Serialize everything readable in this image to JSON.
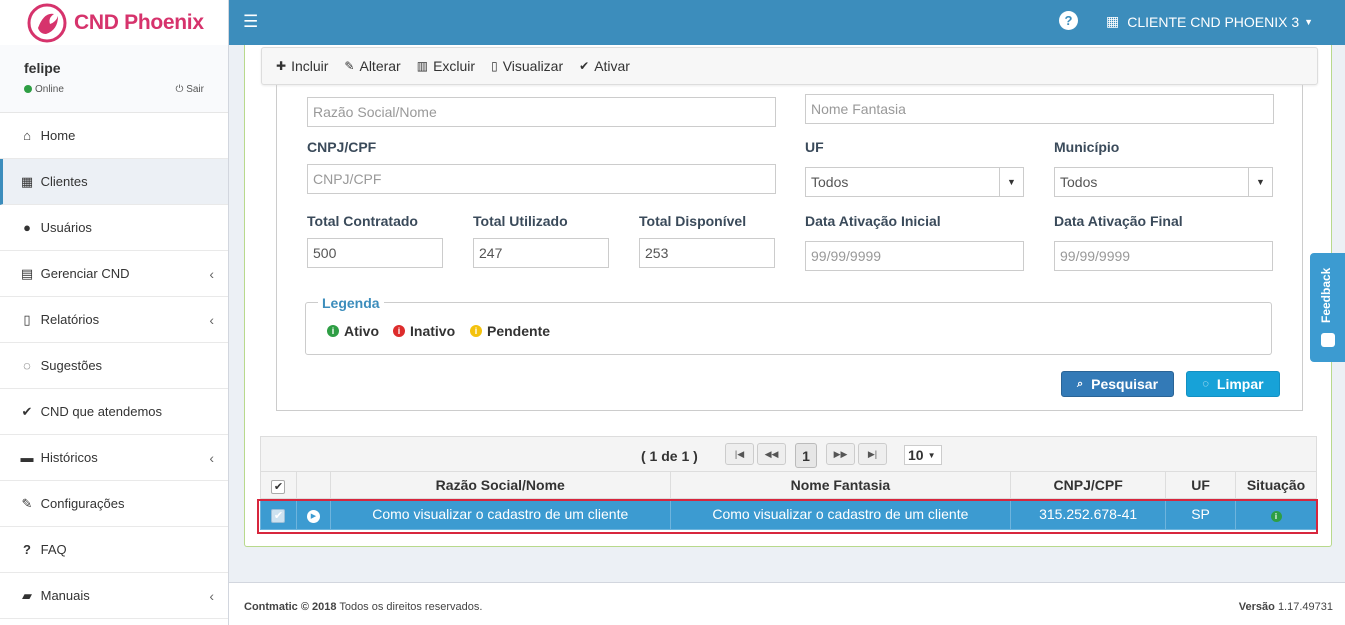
{
  "app": {
    "name": "CND Phoenix"
  },
  "user": {
    "name": "felipe",
    "status": "Online",
    "logout": "Sair"
  },
  "menu": [
    {
      "label": "Home",
      "icon": "home-icon"
    },
    {
      "label": "Clientes",
      "icon": "building-icon",
      "active": true
    },
    {
      "label": "Usuários",
      "icon": "user-icon"
    },
    {
      "label": "Gerenciar CND",
      "icon": "calendar-icon",
      "has_sub": true
    },
    {
      "label": "Relatórios",
      "icon": "file-icon",
      "has_sub": true
    },
    {
      "label": "Sugestões",
      "icon": "comments-icon"
    },
    {
      "label": "CND que atendemos",
      "icon": "check-icon"
    },
    {
      "label": "Históricos",
      "icon": "archive-icon",
      "has_sub": true
    },
    {
      "label": "Configurações",
      "icon": "wrench-icon"
    },
    {
      "label": "FAQ",
      "icon": "question-icon"
    },
    {
      "label": "Manuais",
      "icon": "book-icon",
      "has_sub": true
    }
  ],
  "topbar": {
    "client_label": "CLIENTE CND PHOENIX 3"
  },
  "toolbar": {
    "incluir": "Incluir",
    "alterar": "Alterar",
    "excluir": "Excluir",
    "visualizar": "Visualizar",
    "ativar": "Ativar"
  },
  "form": {
    "razao_placeholder": "Razão Social/Nome",
    "fantasia_placeholder": "Nome Fantasia",
    "cnpj_label": "CNPJ/CPF",
    "cnpj_placeholder": "CNPJ/CPF",
    "uf_label": "UF",
    "uf_value": "Todos",
    "municipio_label": "Município",
    "municipio_value": "Todos",
    "total_contratado_label": "Total Contratado",
    "total_contratado_value": "500",
    "total_utilizado_label": "Total Utilizado",
    "total_utilizado_value": "247",
    "total_disponivel_label": "Total Disponível",
    "total_disponivel_value": "253",
    "data_inicial_label": "Data Ativação Inicial",
    "data_inicial_placeholder": "99/99/9999",
    "data_final_label": "Data Ativação Final",
    "data_final_placeholder": "99/99/9999"
  },
  "legend": {
    "title": "Legenda",
    "ativo": "Ativo",
    "inativo": "Inativo",
    "pendente": "Pendente"
  },
  "buttons": {
    "pesquisar": "Pesquisar",
    "limpar": "Limpar"
  },
  "pager": {
    "text": "( 1 de 1 )",
    "page": "1",
    "size": "10"
  },
  "grid": {
    "headers": [
      "Razão Social/Nome",
      "Nome Fantasia",
      "CNPJ/CPF",
      "UF",
      "Situação"
    ],
    "rows": [
      {
        "razao": "Como visualizar o cadastro de um cliente",
        "fantasia": "Como visualizar o cadastro de um cliente",
        "cnpj": "315.252.678-41",
        "uf": "SP",
        "situacao": "Ativo"
      }
    ]
  },
  "footer": {
    "brand": "Contmatic © 2018",
    "rights": "Todos os direitos reservados.",
    "version_label": "Versão",
    "version": "1.17.49731"
  },
  "feedback": {
    "label": "Feedback"
  },
  "colors": {
    "primary": "#3c8dbc",
    "brand": "#d6336c",
    "ativo": "#2e9e44",
    "inativo": "#dd2c2c",
    "pendente": "#f4c20d",
    "highlight": "#d7263d"
  }
}
